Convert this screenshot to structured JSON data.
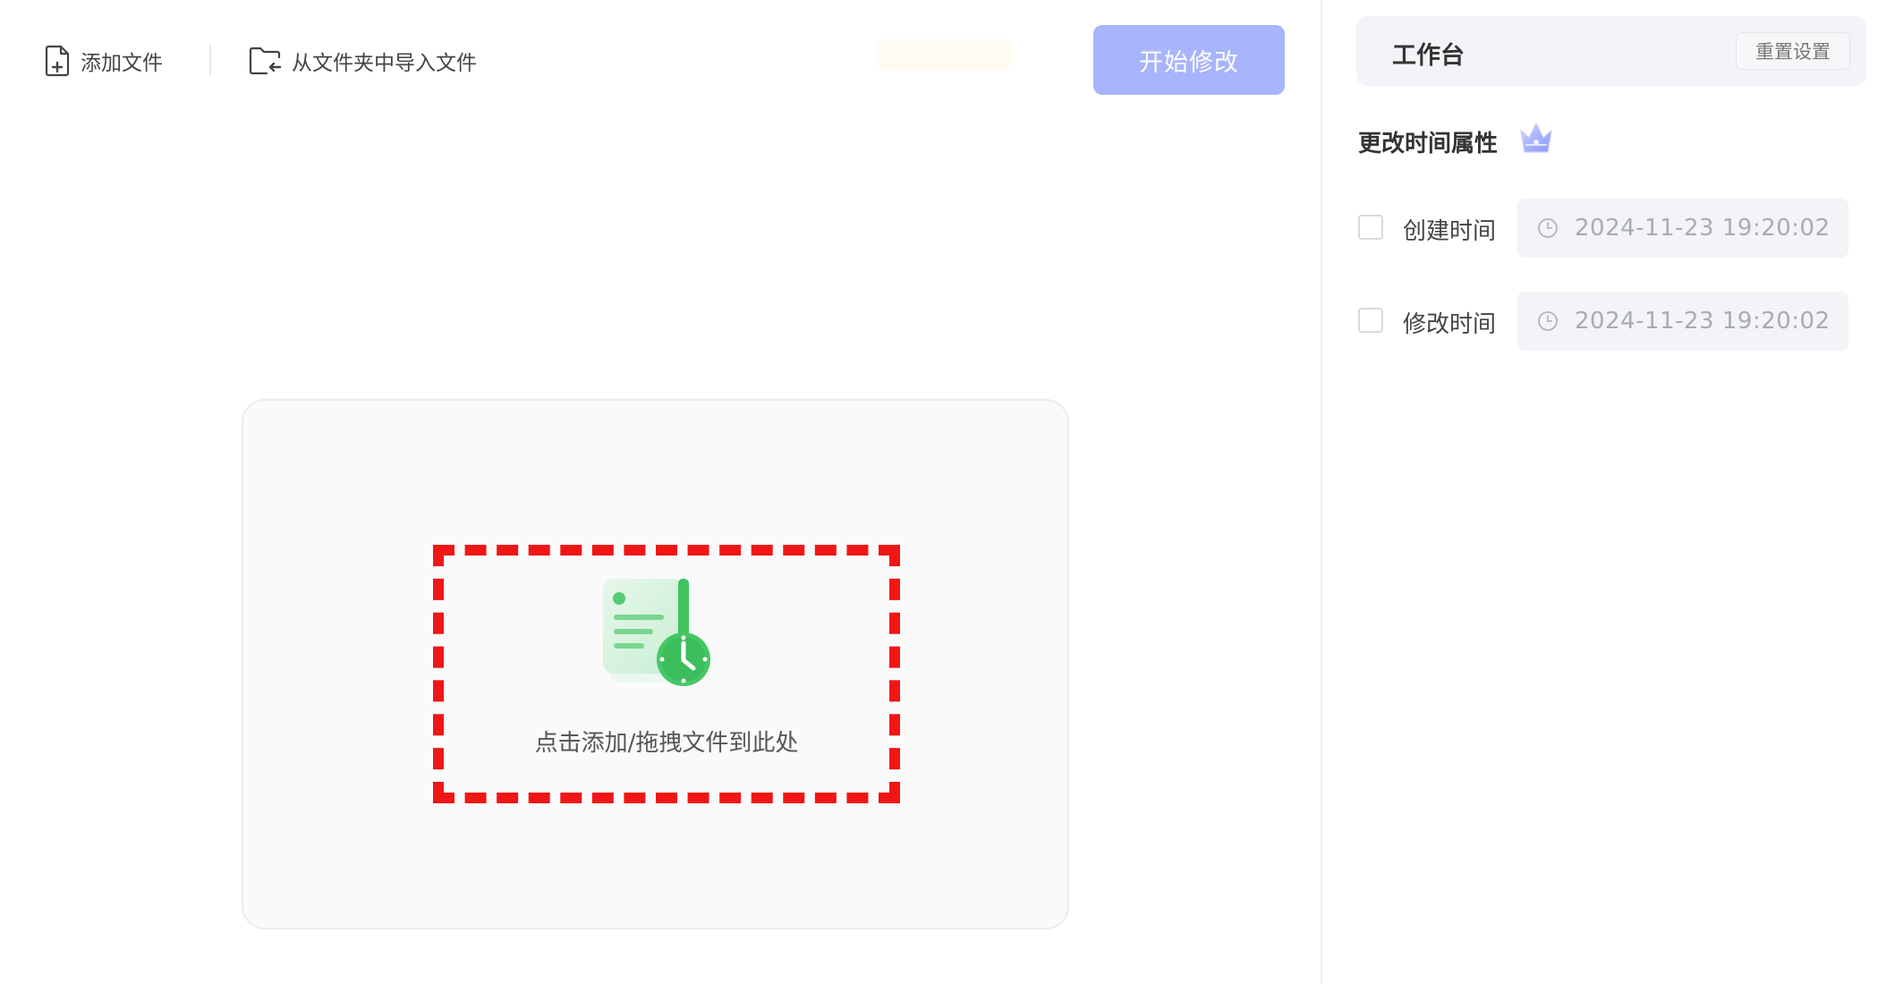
{
  "toolbar": {
    "add_file_label": "添加文件",
    "import_folder_label": "从文件夹中导入文件",
    "start_label": "开始修改"
  },
  "dropzone": {
    "text": "点击添加/拖拽文件到此处"
  },
  "panel": {
    "title": "工作台",
    "reset_label": "重置设置",
    "section_title": "更改时间属性",
    "rows": [
      {
        "label": "创建时间",
        "value": "2024-11-23 19:20:02",
        "checked": false
      },
      {
        "label": "修改时间",
        "value": "2024-11-23 19:20:02",
        "checked": false
      }
    ]
  },
  "colors": {
    "accent_button": "#a8b4fb",
    "highlight_dash": "#f01616",
    "icon_green": "#43c463",
    "panel_bg": "#f3f4f7"
  },
  "icons": {
    "add_file": "file-plus-icon",
    "import_folder": "folder-import-icon",
    "drop": "file-clock-icon",
    "vip": "crown-icon",
    "time": "clock-icon"
  }
}
